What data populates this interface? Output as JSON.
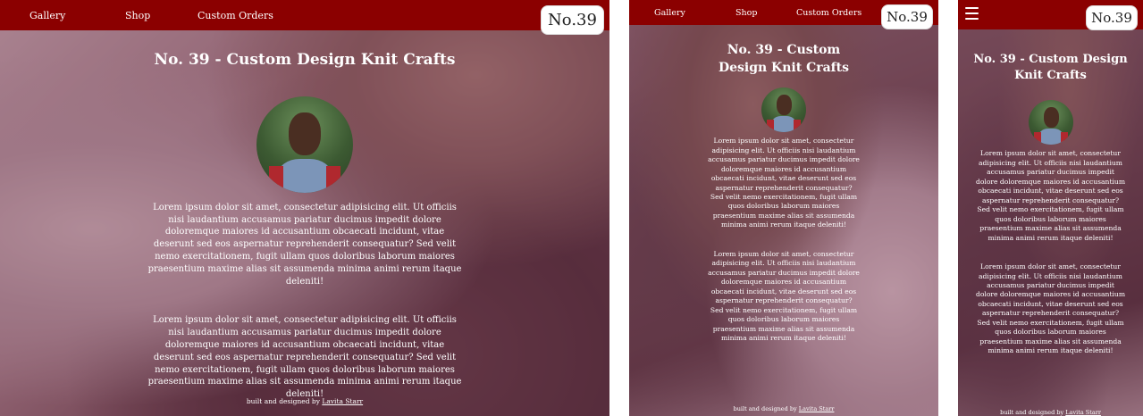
{
  "nav": {
    "gallery": "Gallery",
    "shop": "Shop",
    "custom_orders": "Custom Orders",
    "logo": "No.39"
  },
  "hero": {
    "title": "No. 39 - Custom Design Knit Crafts"
  },
  "paragraphs": {
    "first": "Lorem ipsum dolor sit amet, consectetur adipisicing elit. Ut officiis nisi laudantium accusamus pariatur ducimus impedit dolore doloremque maiores id accusantium obcaecati incidunt, vitae deserunt sed eos aspernatur reprehenderit consequatur? Sed velit nemo exercitationem, fugit ullam quos doloribus laborum maiores praesentium maxime alias sit assumenda minima animi rerum itaque deleniti!",
    "second": "Lorem ipsum dolor sit amet, consectetur adipisicing elit. Ut officiis nisi laudantium accusamus pariatur ducimus impedit dolore doloremque maiores id accusantium obcaecati incidunt, vitae deserunt sed eos aspernatur reprehenderit consequatur? Sed velit nemo exercitationem, fugit ullam quos doloribus laborum maiores praesentium maxime alias sit assumenda minima animi rerum itaque deleniti!"
  },
  "footer": {
    "prefix": "built and designed by ",
    "author": "Lavita Starr"
  },
  "colors": {
    "nav_background": "#8b0000",
    "text": "#ffffff"
  },
  "icons": {
    "menu": "hamburger-menu-icon",
    "avatar": "profile-photo"
  }
}
